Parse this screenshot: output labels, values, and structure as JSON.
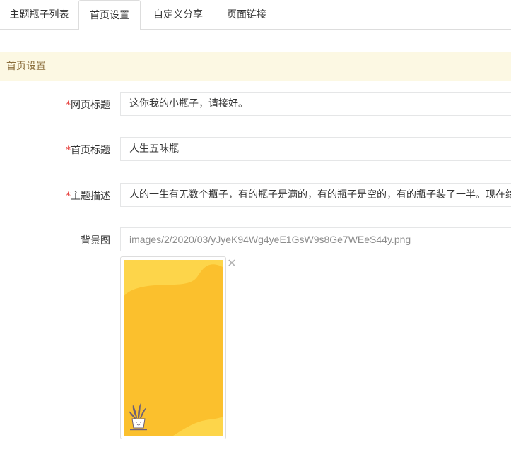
{
  "tabs": [
    {
      "label": "主题瓶子列表"
    },
    {
      "label": "首页设置"
    },
    {
      "label": "自定义分享"
    },
    {
      "label": "页面链接"
    }
  ],
  "active_tab": "首页设置",
  "panel": {
    "title": "首页设置"
  },
  "form": {
    "required_mark": "*",
    "fields": [
      {
        "label": "网页标题",
        "value": "这你我的小瓶子，请接好。",
        "required": true
      },
      {
        "label": "首页标题",
        "value": "人生五味瓶",
        "required": true
      },
      {
        "label": "主题描述",
        "value": "人的一生有无数个瓶子，有的瓶子是满的，有的瓶子是空的，有的瓶子装了一半。现在给",
        "required": true
      },
      {
        "label": "背景图",
        "value": "images/2/2020/03/yJyeK94Wg4yeE1GsW9s8Ge7WEeS44y.png",
        "required": false
      }
    ],
    "remove_icon": "close-icon",
    "image_colors": {
      "base": "#fbc02d",
      "light": "#fdd54a",
      "pot": "#ffffff",
      "plant": "#6d5f78"
    }
  }
}
